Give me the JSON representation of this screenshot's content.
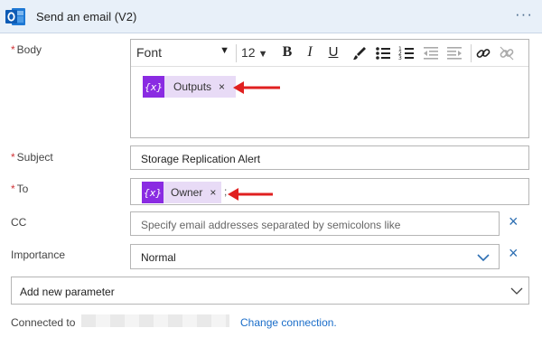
{
  "header": {
    "title": "Send an email (V2)",
    "app_icon": "outlook-icon",
    "more_label": "···"
  },
  "fields": {
    "body": {
      "label": "Body",
      "required_marker": "*",
      "toolbar": {
        "font": "Font",
        "font_size": "12",
        "bold": "B",
        "italic": "I",
        "underline": "U",
        "icons": [
          "paint-brush-icon",
          "bullet-list-icon",
          "numbered-list-icon",
          "outdent-icon",
          "indent-icon",
          "link-icon",
          "unlink-icon"
        ]
      },
      "token": {
        "icon_text": "{x}",
        "label": "Outputs",
        "remove": "×"
      }
    },
    "subject": {
      "label": "Subject",
      "required_marker": "*",
      "value": "Storage Replication Alert"
    },
    "to": {
      "label": "To",
      "required_marker": "*",
      "token": {
        "icon_text": "{x}",
        "label": "Owner",
        "remove": "×"
      },
      "trailing": ";"
    },
    "cc": {
      "label": "CC",
      "placeholder": "Specify email addresses separated by semicolons like",
      "clear": "×"
    },
    "importance": {
      "label": "Importance",
      "value": "Normal",
      "clear": "×"
    },
    "add_parameter": {
      "placeholder": "Add new parameter"
    }
  },
  "footer": {
    "connected_label": "Connected to",
    "change_link": "Change connection."
  },
  "colors": {
    "header_bg": "#e8f0f9",
    "token_bg": "#e8dbf6",
    "token_icon_bg": "#8a2be2",
    "required": "#d13438",
    "link": "#1a6dc9",
    "arrow": "#e02020"
  }
}
